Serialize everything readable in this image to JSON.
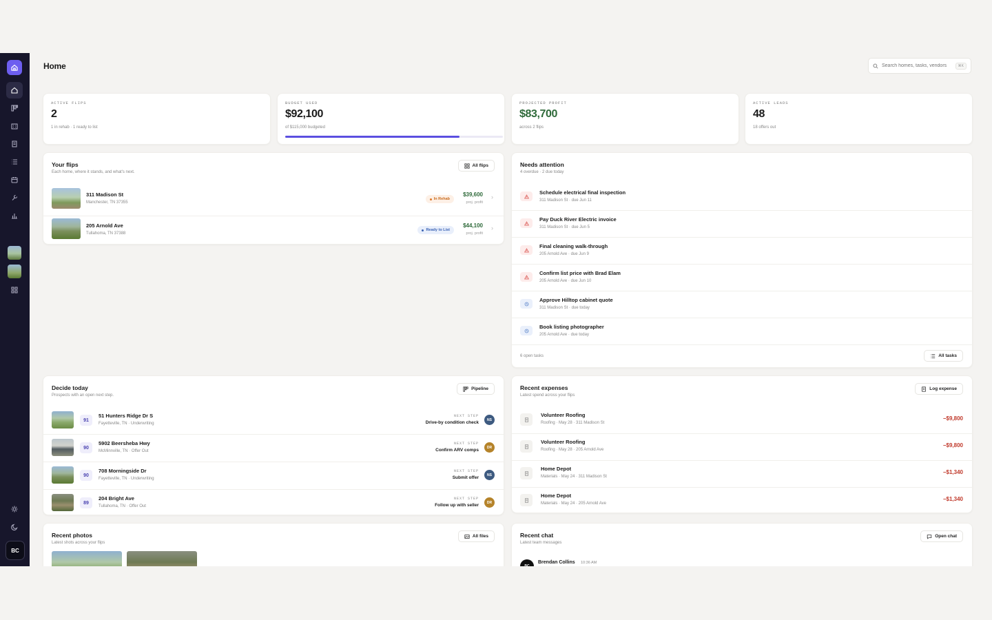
{
  "header": {
    "title": "Home",
    "search_placeholder": "Search homes, tasks, vendors",
    "search_kbd": "⌘K"
  },
  "sidebar": {
    "user_initials": "BC"
  },
  "stats": [
    {
      "label": "ACTIVE FLIPS",
      "value": "2",
      "sub": "1 in rehab · 1 ready to list"
    },
    {
      "label": "BUDGET USED",
      "value": "$92,100",
      "sub": "of $115,000 budgeted",
      "progress": 0.8
    },
    {
      "label": "PROJECTED PROFIT",
      "value": "$83,700",
      "sub": "across 2 flips",
      "color": "#2f6a3a"
    },
    {
      "label": "ACTIVE LEADS",
      "value": "48",
      "sub": "18 offers out"
    }
  ],
  "flips": {
    "title": "Your flips",
    "sub": "Each home, where it stands, and what's next.",
    "button": "All flips",
    "items": [
      {
        "name": "311 Madison St",
        "addr": "Manchester, TN 37355",
        "status": "In Rehab",
        "profit": "$39,600",
        "profit_label": "proj. profit"
      },
      {
        "name": "205 Arnold Ave",
        "addr": "Tullahoma, TN 37388",
        "status": "Ready to List",
        "profit": "$44,100",
        "profit_label": "proj. profit"
      }
    ]
  },
  "attention": {
    "title": "Needs attention",
    "sub": "4 overdue · 2 due today",
    "footer": "6 open tasks",
    "button": "All tasks",
    "items": [
      {
        "title": "Schedule electrical final inspection",
        "sub": "311 Madison St · due Jun 11",
        "kind": "warn"
      },
      {
        "title": "Pay Duck River Electric invoice",
        "sub": "311 Madison St · due Jun 5",
        "kind": "warn"
      },
      {
        "title": "Final cleaning walk-through",
        "sub": "205 Arnold Ave · due Jun 9",
        "kind": "warn"
      },
      {
        "title": "Confirm list price with Brad Elam",
        "sub": "205 Arnold Ave · due Jun 10",
        "kind": "warn"
      },
      {
        "title": "Approve Hilltop cabinet quote",
        "sub": "311 Madison St · due today",
        "kind": "clock"
      },
      {
        "title": "Book listing photographer",
        "sub": "205 Arnold Ave · due today",
        "kind": "clock"
      }
    ]
  },
  "decide": {
    "title": "Decide today",
    "sub": "Prospects with an open next step.",
    "button": "Pipeline",
    "next_label": "NEXT STEP",
    "items": [
      {
        "score": "91",
        "name": "51 Hunters Ridge Dr S",
        "sub": "Fayetteville, TN · Underwriting",
        "next": "Drive-by condition check",
        "initials": "NS",
        "color": "#3d5a80"
      },
      {
        "score": "90",
        "name": "5902 Beersheba Hwy",
        "sub": "McMinnville, TN · Offer Out",
        "next": "Confirm ARV comps",
        "initials": "DR",
        "color": "#b5832a"
      },
      {
        "score": "90",
        "name": "708 Morningside Dr",
        "sub": "Fayetteville, TN · Underwriting",
        "next": "Submit offer",
        "initials": "NS",
        "color": "#3d5a80"
      },
      {
        "score": "89",
        "name": "204 Bright Ave",
        "sub": "Tullahoma, TN · Offer Out",
        "next": "Follow up with seller",
        "initials": "DR",
        "color": "#b5832a"
      }
    ]
  },
  "expenses": {
    "title": "Recent expenses",
    "sub": "Latest spend across your flips",
    "button": "Log expense",
    "items": [
      {
        "vendor": "Volunteer Roofing",
        "sub": "Roofing · May 28 · 311 Madison St",
        "amount": "−$9,800"
      },
      {
        "vendor": "Volunteer Roofing",
        "sub": "Roofing · May 28 · 205 Arnold Ave",
        "amount": "−$9,800"
      },
      {
        "vendor": "Home Depot",
        "sub": "Materials · May 24 · 311 Madison St",
        "amount": "−$1,340"
      },
      {
        "vendor": "Home Depot",
        "sub": "Materials · May 24 · 205 Arnold Ave",
        "amount": "−$1,340"
      }
    ]
  },
  "photos": {
    "title": "Recent photos",
    "sub": "Latest shots across your flips",
    "button": "All files"
  },
  "chat": {
    "title": "Recent chat",
    "sub": "Latest team messages",
    "button": "Open chat",
    "first_author": "Brendan Collins",
    "first_time": "10:36 AM",
    "first_initials": "BC"
  },
  "colors": {
    "accent": "#5b4fe0",
    "sidebar": "#17162b",
    "profit": "#2f6a3a",
    "expense": "#c0392b"
  }
}
